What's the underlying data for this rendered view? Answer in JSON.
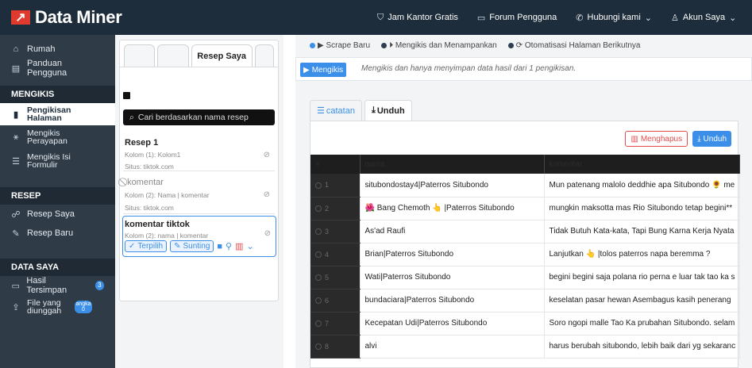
{
  "brand": {
    "name": "Data Miner"
  },
  "topnav": [
    {
      "icon": "graduation-cap-icon",
      "label": "Jam Kantor Gratis"
    },
    {
      "icon": "chat-bubbles-icon",
      "label": "Forum Pengguna"
    },
    {
      "icon": "phone-icon",
      "label": "Hubungi kami",
      "dropdown": true
    },
    {
      "icon": "user-icon",
      "label": "Akun Saya",
      "dropdown": true
    }
  ],
  "sidebar": {
    "top": [
      {
        "icon": "home-icon",
        "label": "Rumah"
      },
      {
        "icon": "book-icon",
        "label": "Panduan Pengguna"
      }
    ],
    "sections": [
      {
        "title": "MENGIKIS",
        "items": [
          {
            "icon": "page-icon",
            "label": "Pengikisan Halaman",
            "active": true
          },
          {
            "icon": "crawl-icon",
            "label": "Mengikis Perayapan"
          },
          {
            "icon": "form-icon",
            "label": "Mengikis Isi Formulir"
          }
        ]
      },
      {
        "title": "RESEP",
        "items": [
          {
            "icon": "users-icon",
            "label": "Resep Saya"
          },
          {
            "icon": "pencil-icon",
            "label": "Resep Baru"
          }
        ]
      },
      {
        "title": "DATA SAYA",
        "items": [
          {
            "icon": "folder-icon",
            "label": "Hasil Tersimpan",
            "badge": "3"
          },
          {
            "icon": "upload-icon",
            "label": "File yang diunggah",
            "badge": "angka 0"
          }
        ]
      }
    ]
  },
  "recipes_panel": {
    "active_tab": "Resep Saya",
    "search_placeholder": "Cari berdasarkan nama resep",
    "recipes": [
      {
        "title": "Resep 1",
        "columns": "Kolom (1): Kolom1",
        "site": "Situs: tiktok.com"
      },
      {
        "title": "komentar",
        "columns": "Kolom (2): Nama | komentar",
        "site": "Situs: tiktok.com"
      },
      {
        "title": "komentar tiktok",
        "columns": "Kolom (2): nama | komentar",
        "selected_label": "Terpilih",
        "edit_label": "Sunting"
      }
    ]
  },
  "main": {
    "legend": [
      "Scrape Baru",
      "Mengikis dan Menampankan",
      "Otomatisasi Halaman Berikutnya"
    ],
    "mode_button": "Mengikis",
    "mode_description": "Mengikis dan hanya menyimpan data hasil dari 1 pengikisan.",
    "tabs": [
      {
        "label": "catatan"
      },
      {
        "label": "Unduh",
        "active": true
      }
    ],
    "actions": {
      "delete": "Menghapus",
      "download": "Unduh"
    },
    "table": {
      "headers": [
        "#",
        "nama",
        "komentar"
      ],
      "rows": [
        {
          "n": "1",
          "nama": "situbondostay4|Paterros Situbondo",
          "komentar": "Mun patenang malolo deddhie apa Situbondo 🌻 me"
        },
        {
          "n": "2",
          "nama": "🌺 Bang Chemoth 👆 |Paterros Situbondo",
          "komentar": "mungkin maksotta mas Rio Situbondo tetap begini**"
        },
        {
          "n": "3",
          "nama": "As'ad Raufi",
          "komentar": "Tidak Butuh Kata-kata, Tapi Bung Karna Kerja Nyata"
        },
        {
          "n": "4",
          "nama": "Brian|Paterros Situbondo",
          "komentar": "Lanjutkan 👆 |tolos paterros napa beremma ?"
        },
        {
          "n": "5",
          "nama": "Wati|Paterros Situbondo",
          "komentar": "begini begini saja polana rio perna e luar tak tao ka s"
        },
        {
          "n": "6",
          "nama": "bundaciara|Paterros Situbondo",
          "komentar": "keselatan pasar hewan Asembagus kasih penerang"
        },
        {
          "n": "7",
          "nama": "Kecepatan Udi|Paterros Situbondo",
          "komentar": "Soro ngopi malle Tao Ka prubahan Situbondo. selam"
        },
        {
          "n": "8",
          "nama": "alvi",
          "komentar": "harus berubah situbondo, lebih baik dari yg sekaranc"
        }
      ]
    }
  }
}
